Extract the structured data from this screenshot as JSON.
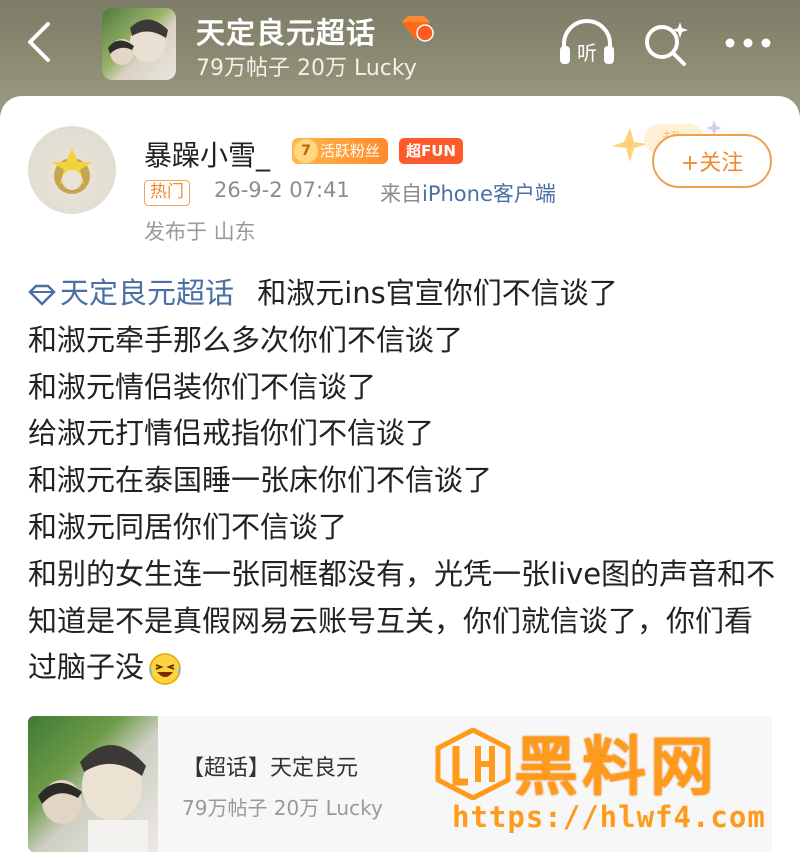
{
  "header": {
    "group_title": "天定良元超话",
    "group_level": "3",
    "group_stats": "79万帖子 20万 Lucky",
    "listen_label": "听"
  },
  "post": {
    "username": "暴躁小雪_",
    "fan_level": "7",
    "fan_badge": "活跃粉丝",
    "fun_badge": "超FUN",
    "hot_tag": "热门",
    "time": "26-9-2 07:41",
    "source_prefix": "来自",
    "source_device": "iPhone客户端",
    "location": "发布于 山东",
    "follow_label": "+关注",
    "star_label": "超",
    "topic_link": "天定良元超话",
    "lines": [
      "和淑元ins官宣你们不信谈了",
      "和淑元牵手那么多次你们不信谈了",
      "和淑元情侣装你们不信谈了",
      "给淑元打情侣戒指你们不信谈了",
      "和淑元在泰国睡一张床你们不信谈了",
      "和淑元同居你们不信谈了",
      "和别的女生连一张同框都没有，光凭一张live图的声音和不知道是不是真假网易云账号互关，你们就信谈了，你们看过脑子没"
    ]
  },
  "topic_card": {
    "title": "【超话】天定良元",
    "stats": "79万帖子 20万 Lucky"
  },
  "watermark": {
    "text": "黑料网",
    "url": "https://hlwf4.com"
  }
}
